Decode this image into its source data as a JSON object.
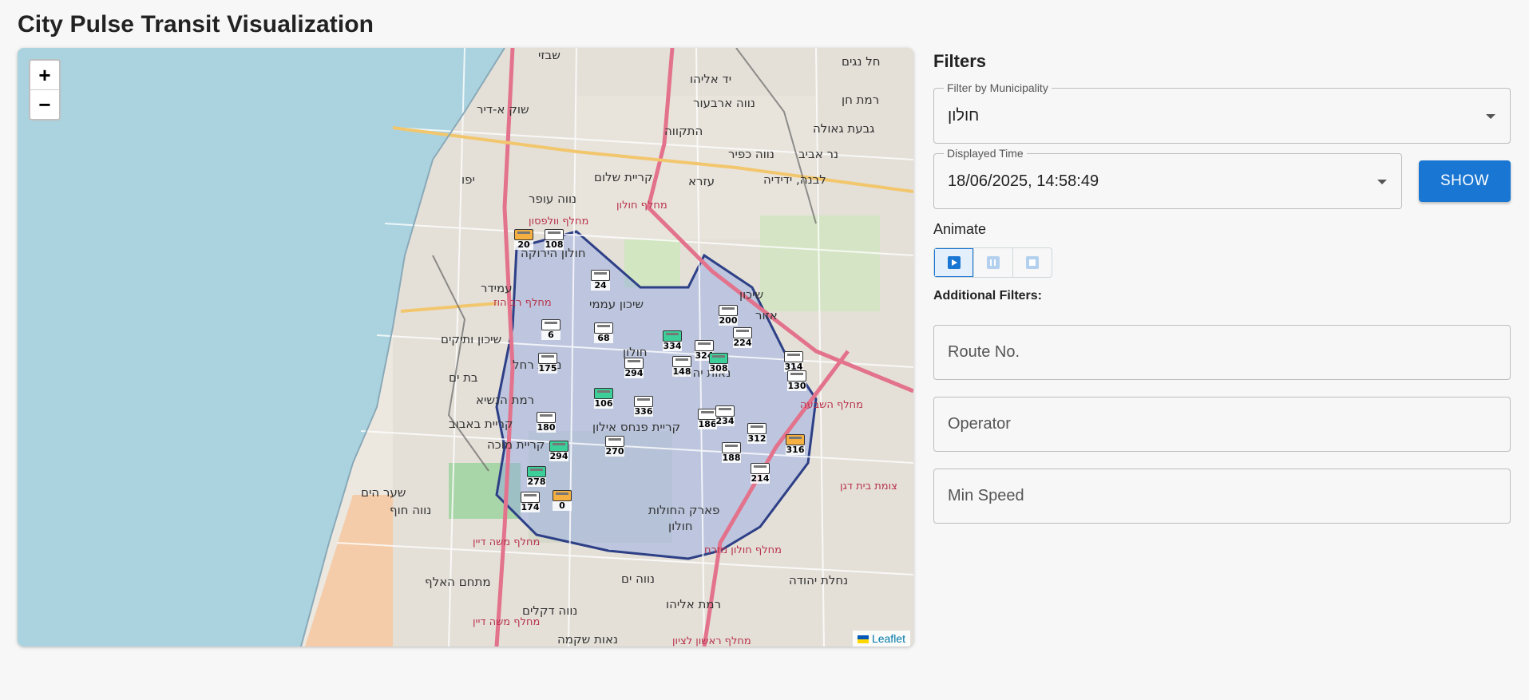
{
  "app": {
    "title": "City Pulse Transit Visualization"
  },
  "map": {
    "zoom_in": "+",
    "zoom_out": "−",
    "attribution": "Leaflet",
    "places": [
      {
        "id": "p1",
        "label": "שבזי"
      },
      {
        "id": "p2",
        "label": "שוק א-דיר"
      },
      {
        "id": "p3",
        "label": "יפו"
      },
      {
        "id": "p4",
        "label": "נווה עופר"
      },
      {
        "id": "p5",
        "label": "קריית שלום"
      },
      {
        "id": "p6",
        "label": "התקווה"
      },
      {
        "id": "p7",
        "label": "יד אליהו"
      },
      {
        "id": "p8",
        "label": "נווה כפיר"
      },
      {
        "id": "p9",
        "label": "עזרא"
      },
      {
        "id": "p10",
        "label": "חולון הירוקה"
      },
      {
        "id": "p11",
        "label": "עמידר"
      },
      {
        "id": "p12",
        "label": "שיכון עממי"
      },
      {
        "id": "p13",
        "label": "שיכון ותיקים"
      },
      {
        "id": "p14",
        "label": "חולון"
      },
      {
        "id": "p15",
        "label": "בת ים"
      },
      {
        "id": "p16",
        "label": "נאות רחל"
      },
      {
        "id": "p17",
        "label": "רמת הנשיא"
      },
      {
        "id": "p18",
        "label": "קריית באבוב"
      },
      {
        "id": "p19",
        "label": "קריית פנחס אילון"
      },
      {
        "id": "p20",
        "label": "קריית מוכה"
      },
      {
        "id": "p21",
        "label": "פארק החולות"
      },
      {
        "id": "p22",
        "label": "חולון"
      },
      {
        "id": "p23",
        "label": "שער הים"
      },
      {
        "id": "p24",
        "label": "נווה חוף"
      },
      {
        "id": "p25",
        "label": "נווה ים"
      },
      {
        "id": "p26",
        "label": "רמת אליהו"
      },
      {
        "id": "p27",
        "label": "נחלת יהודה"
      },
      {
        "id": "p28",
        "label": "נווה דקלים"
      },
      {
        "id": "p29",
        "label": "נאות שקמה"
      },
      {
        "id": "p30",
        "label": "רמת חן"
      },
      {
        "id": "p31",
        "label": "גבעת גאולה"
      },
      {
        "id": "p32",
        "label": "נר אביב"
      },
      {
        "id": "p33",
        "label": "לבנה, ידידיה"
      },
      {
        "id": "p34",
        "label": "נווה ארבעור"
      },
      {
        "id": "p35",
        "label": "חל נגים"
      },
      {
        "id": "p36",
        "label": "נאות יהודית"
      },
      {
        "id": "p37",
        "label": "אזור"
      },
      {
        "id": "p38",
        "label": "שיכון"
      },
      {
        "id": "p39",
        "label": "מתחם האלף"
      }
    ],
    "red_labels": [
      {
        "id": "r1",
        "label": "מחלף חולון"
      },
      {
        "id": "r2",
        "label": "מחלף וולפסון"
      },
      {
        "id": "r3",
        "label": "מחלף רב הוז"
      },
      {
        "id": "r4",
        "label": "מחלף משה דיין"
      },
      {
        "id": "r5",
        "label": "מחלף חולון מזרח"
      },
      {
        "id": "r6",
        "label": "מחלף השבעה"
      },
      {
        "id": "r7",
        "label": "צומת בית דגן"
      },
      {
        "id": "r8",
        "label": "מחלף משה דיין"
      },
      {
        "id": "r9",
        "label": "מחלף ראשון לציון"
      }
    ],
    "buses": [
      {
        "route": "20",
        "color": "orange"
      },
      {
        "route": "108",
        "color": "white"
      },
      {
        "route": "24",
        "color": "white"
      },
      {
        "route": "6",
        "color": "white"
      },
      {
        "route": "68",
        "color": "white"
      },
      {
        "route": "334",
        "color": "green"
      },
      {
        "route": "324",
        "color": "white"
      },
      {
        "route": "200",
        "color": "white"
      },
      {
        "route": "224",
        "color": "white"
      },
      {
        "route": "175",
        "color": "white"
      },
      {
        "route": "294",
        "color": "white"
      },
      {
        "route": "148",
        "color": "white"
      },
      {
        "route": "308",
        "color": "green"
      },
      {
        "route": "314",
        "color": "white"
      },
      {
        "route": "130",
        "color": "white"
      },
      {
        "route": "106",
        "color": "green"
      },
      {
        "route": "336",
        "color": "white"
      },
      {
        "route": "186",
        "color": "white"
      },
      {
        "route": "234",
        "color": "white"
      },
      {
        "route": "180",
        "color": "white"
      },
      {
        "route": "270",
        "color": "white"
      },
      {
        "route": "312",
        "color": "white"
      },
      {
        "route": "316",
        "color": "orange"
      },
      {
        "route": "294",
        "color": "green"
      },
      {
        "route": "188",
        "color": "white"
      },
      {
        "route": "278",
        "color": "green"
      },
      {
        "route": "214",
        "color": "white"
      },
      {
        "route": "174",
        "color": "white"
      },
      {
        "route": "0",
        "color": "orange"
      }
    ]
  },
  "filters": {
    "heading": "Filters",
    "municipality": {
      "label": "Filter by Municipality",
      "value": "חולון"
    },
    "time": {
      "label": "Displayed Time",
      "value": "18/06/2025, 14:58:49"
    },
    "show_button": "SHOW",
    "animate_label": "Animate",
    "additional_label": "Additional Filters:",
    "route_placeholder": "Route No.",
    "operator_placeholder": "Operator",
    "speed_placeholder": "Min Speed"
  },
  "colors": {
    "accent": "#1976d2",
    "sea": "#aad3df",
    "municipality_fill": "#8ea6e6",
    "municipality_border": "#2d3f86",
    "highway": "#e3728c"
  }
}
